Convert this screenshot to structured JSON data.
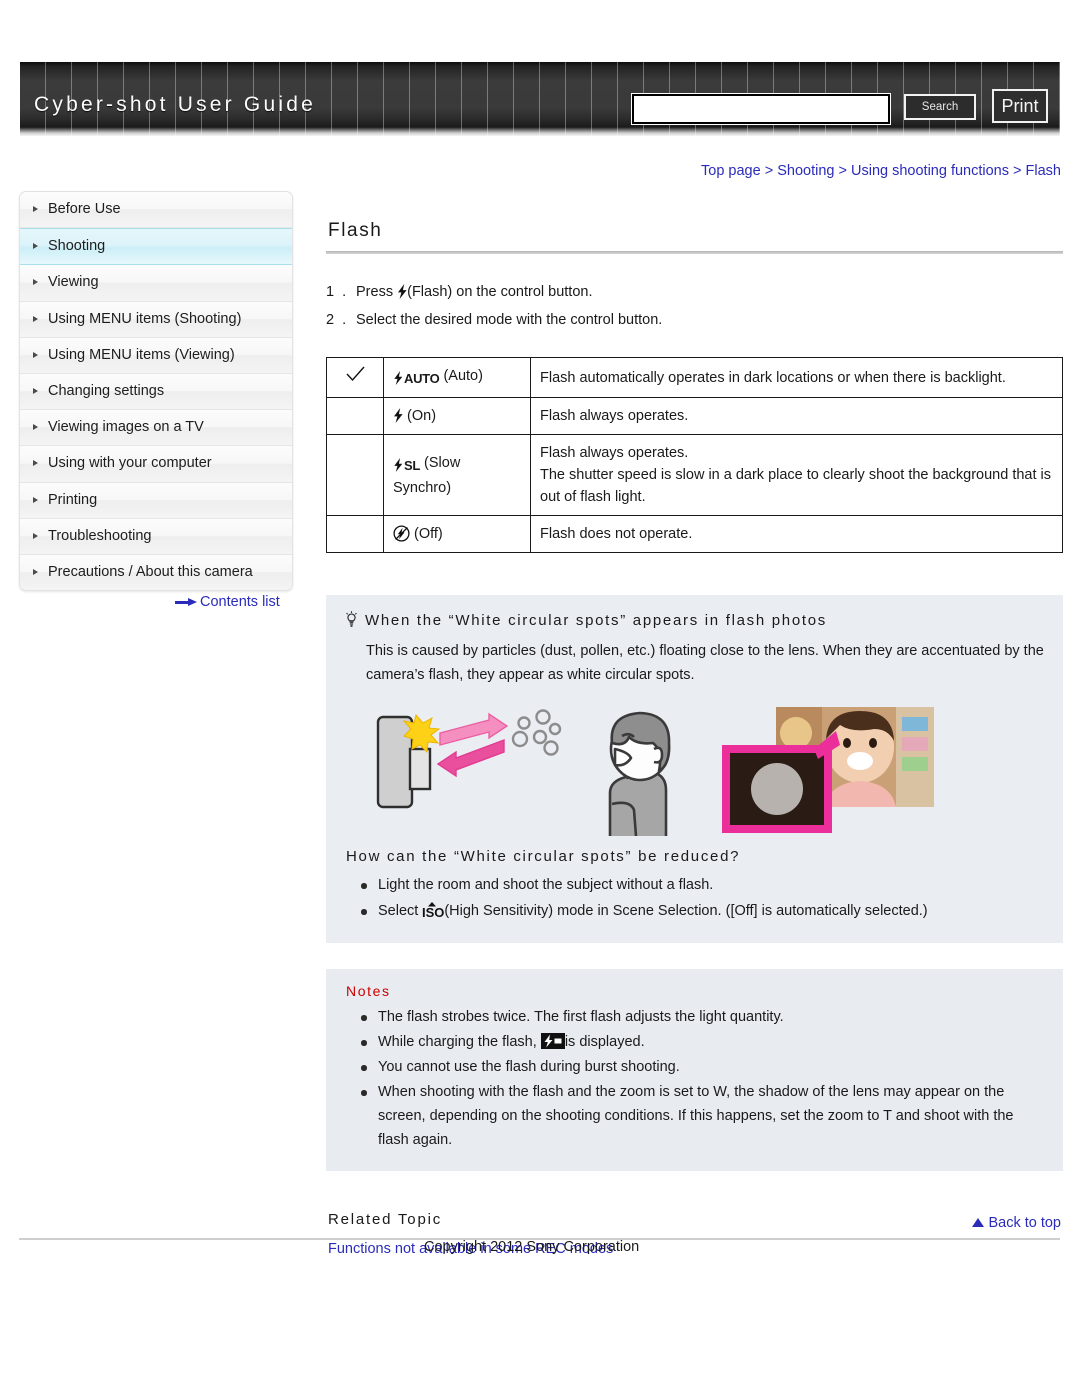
{
  "header": {
    "title": "Cyber-shot User Guide",
    "search_value": "",
    "search_placeholder": "",
    "search_label": "Search",
    "print_label": "Print"
  },
  "breadcrumb": {
    "items": [
      "Top page",
      "Shooting",
      "Using shooting functions",
      "Flash"
    ],
    "separator": ">"
  },
  "sidebar": {
    "items": [
      {
        "label": "Before Use",
        "active": false
      },
      {
        "label": "Shooting",
        "active": true
      },
      {
        "label": "Viewing",
        "active": false
      },
      {
        "label": "Using MENU items (Shooting)",
        "active": false
      },
      {
        "label": "Using MENU items (Viewing)",
        "active": false
      },
      {
        "label": "Changing settings",
        "active": false
      },
      {
        "label": "Viewing images on a TV",
        "active": false
      },
      {
        "label": "Using with your computer",
        "active": false
      },
      {
        "label": "Printing",
        "active": false
      },
      {
        "label": "Troubleshooting",
        "active": false
      },
      {
        "label": "Precautions / About this camera",
        "active": false
      }
    ],
    "contents_list_label": "Contents list"
  },
  "main": {
    "title": "Flash",
    "steps": [
      {
        "num": "1 .",
        "before": "Press",
        "icon": "flash-bolt-icon",
        "after": "(Flash) on the control button."
      },
      {
        "num": "2 .",
        "before": "Select the desired mode with the control button.",
        "icon": "",
        "after": ""
      }
    ],
    "table": {
      "rows": [
        {
          "checked": true,
          "icon": "flash-auto-icon",
          "icon_text": "AUTO",
          "mode": "(Auto)",
          "desc": [
            "Flash automatically operates in dark locations or when there is backlight."
          ]
        },
        {
          "checked": false,
          "icon": "flash-on-icon",
          "icon_text": "",
          "mode": "(On)",
          "desc": [
            "Flash always operates."
          ]
        },
        {
          "checked": false,
          "icon": "flash-slow-synchro-icon",
          "icon_text": "SL",
          "mode": "(Slow Synchro)",
          "desc": [
            "Flash always operates.",
            "The shutter speed is slow in a dark place to clearly shoot the background that is out of flash light."
          ]
        },
        {
          "checked": false,
          "icon": "flash-off-icon",
          "icon_text": "",
          "mode": "(Off)",
          "desc": [
            "Flash does not operate."
          ]
        }
      ]
    },
    "tip": {
      "heading": "When the “White circular spots” appears in flash photos",
      "body": "This is caused by particles (dust, pollen, etc.) floating close to the lens. When they are accentuated by the camera’s flash, they appear as white circular spots.",
      "sub_heading": "How can the “White circular spots” be reduced?",
      "bullets": [
        {
          "before": "Light the room and shoot the subject without a flash.",
          "icon": "",
          "after": ""
        },
        {
          "before": "Select",
          "icon": "iso-icon",
          "after": "(High Sensitivity) mode in Scene Selection. ([Off] is automatically selected.)"
        }
      ]
    },
    "notes": {
      "heading": "Notes",
      "items": [
        {
          "before": "The flash strobes twice. The first flash adjusts the light quantity.",
          "icon": "",
          "after": ""
        },
        {
          "before": "While charging the flash,",
          "icon": "flash-charging-icon",
          "after": "is displayed."
        },
        {
          "before": "You cannot use the flash during burst shooting.",
          "icon": "",
          "after": ""
        },
        {
          "before": "When shooting with the flash and the zoom is set to W, the shadow of the lens may appear on the screen, depending on the shooting conditions. If this happens, set the zoom to T and shoot with the flash again.",
          "icon": "",
          "after": ""
        }
      ]
    },
    "related": {
      "heading": "Related Topic",
      "link": "Functions not available in some REC modes"
    }
  },
  "footer": {
    "back_to_top": "Back to top",
    "copyright": "Copyright 2012 Sony Corporation"
  },
  "colors": {
    "link": "#2b2bbb",
    "notes_heading": "#cc0000",
    "sidebar_active": "#ddf4fa",
    "tip_bg": "#eaeef3",
    "accent_pink": "#ef5aa0"
  }
}
